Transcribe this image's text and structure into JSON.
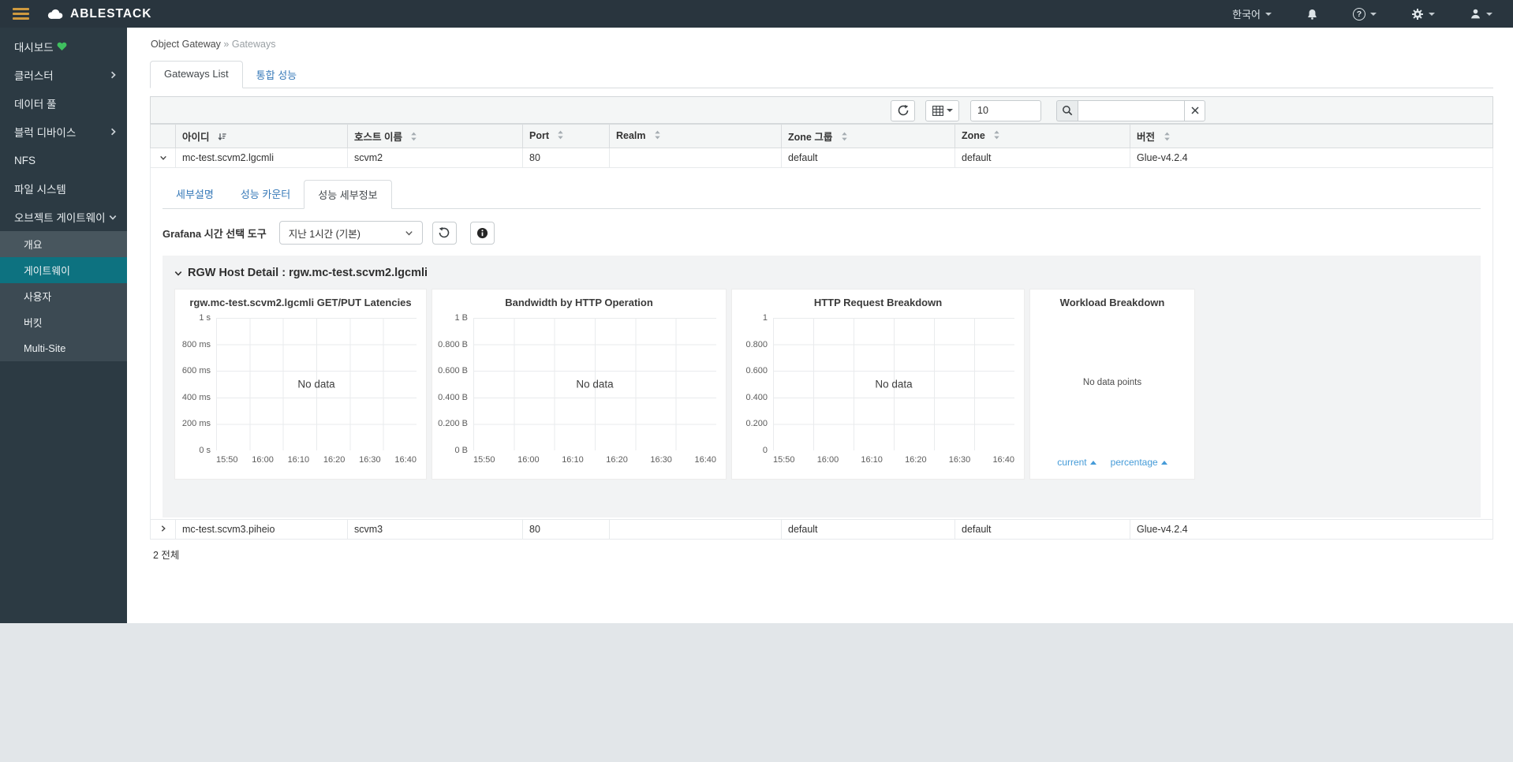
{
  "navbar": {
    "brand": "ABLESTACK",
    "language": "한국어",
    "icons": {
      "help": "?"
    }
  },
  "sidebar": {
    "items": [
      {
        "label": "대시보드"
      },
      {
        "label": "클러스터"
      },
      {
        "label": "데이터 풀"
      },
      {
        "label": "블럭 디바이스"
      },
      {
        "label": "NFS"
      },
      {
        "label": "파일 시스템"
      },
      {
        "label": "오브젝트 게이트웨이"
      }
    ],
    "submenu": [
      {
        "label": "개요"
      },
      {
        "label": "게이트웨이"
      },
      {
        "label": "사용자"
      },
      {
        "label": "버킷"
      },
      {
        "label": "Multi-Site"
      }
    ]
  },
  "breadcrumb": {
    "section": "Object Gateway",
    "separator": "»",
    "page": "Gateways"
  },
  "tabs": {
    "gateways_list": "Gateways List",
    "overall_performance": "통합 성능"
  },
  "toolbar": {
    "page_size": "10",
    "search_value": ""
  },
  "table": {
    "headers": [
      "아이디",
      "호스트 이름",
      "Port",
      "Realm",
      "Zone 그룹",
      "Zone",
      "버전"
    ],
    "rows": [
      {
        "id": "mc-test.scvm2.lgcmli",
        "host": "scvm2",
        "port": "80",
        "realm": "",
        "zone_group": "default",
        "zone": "default",
        "version": "Glue-v4.2.4"
      },
      {
        "id": "mc-test.scvm3.piheio",
        "host": "scvm3",
        "port": "80",
        "realm": "",
        "zone_group": "default",
        "zone": "default",
        "version": "Glue-v4.2.4"
      }
    ],
    "footer_total": "2 전체"
  },
  "detail": {
    "tabs": [
      "세부설명",
      "성능 카운터",
      "성능 세부정보"
    ],
    "grafana_label": "Grafana 시간 선택 도구",
    "time_range": "지난 1시간 (기본)",
    "section_title": "RGW Host Detail : rgw.mc-test.scvm2.lgcmli"
  },
  "chart_data": [
    {
      "type": "line",
      "title": "rgw.mc-test.scvm2.lgcmli GET/PUT Latencies",
      "y_ticks": [
        "1 s",
        "800 ms",
        "600 ms",
        "400 ms",
        "200 ms",
        "0 s"
      ],
      "x_ticks": [
        "15:50",
        "16:00",
        "16:10",
        "16:20",
        "16:30",
        "16:40"
      ],
      "ylim": [
        "0 s",
        "1 s"
      ],
      "grid": true,
      "series": [],
      "message": "No data"
    },
    {
      "type": "line",
      "title": "Bandwidth by HTTP Operation",
      "y_ticks": [
        "1 B",
        "0.800 B",
        "0.600 B",
        "0.400 B",
        "0.200 B",
        "0 B"
      ],
      "x_ticks": [
        "15:50",
        "16:00",
        "16:10",
        "16:20",
        "16:30",
        "16:40"
      ],
      "ylim": [
        "0 B",
        "1 B"
      ],
      "grid": true,
      "series": [],
      "message": "No data"
    },
    {
      "type": "line",
      "title": "HTTP Request Breakdown",
      "y_ticks": [
        "1",
        "0.800",
        "0.600",
        "0.400",
        "0.200",
        "0"
      ],
      "x_ticks": [
        "15:50",
        "16:00",
        "16:10",
        "16:20",
        "16:30",
        "16:40"
      ],
      "ylim": [
        "0",
        "1"
      ],
      "grid": true,
      "series": [],
      "message": "No data"
    },
    {
      "type": "pie",
      "title": "Workload Breakdown",
      "message": "No data points",
      "legend": [
        "current",
        "percentage"
      ],
      "series": []
    }
  ],
  "colors": {
    "navbar_bg": "#29353e",
    "sidebar_bg": "#2c3a43",
    "accent_teal": "#0d7280",
    "link_blue": "#3679b8",
    "legend_blue": "#459bd8",
    "heart_green": "#3fbf5f",
    "hamburger_amber": "#cf9a3f"
  }
}
